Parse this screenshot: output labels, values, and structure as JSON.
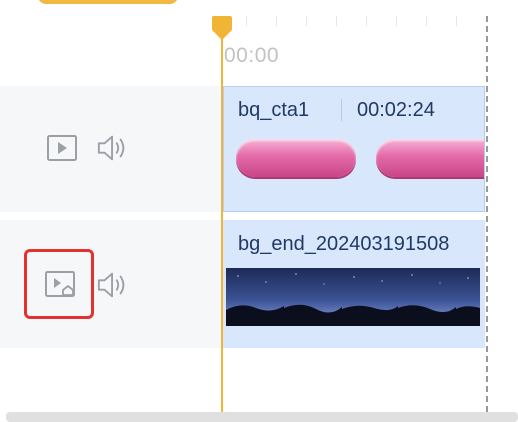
{
  "ruler": {
    "time_label": "00:00"
  },
  "tracks": [
    {
      "clip": {
        "name": "bq_cta1",
        "duration": "00:02:24"
      },
      "icons": {
        "play": "play-square-icon",
        "audio": "speaker-icon"
      }
    },
    {
      "clip": {
        "name": "bg_end_202403191508"
      },
      "icons": {
        "cover": "cover-image-icon",
        "audio": "speaker-icon"
      }
    }
  ],
  "colors": {
    "playhead": "#f1b434",
    "clip_bg": "#d8e7fb",
    "highlight": "#e2322f",
    "pill": "#e46aa9"
  }
}
